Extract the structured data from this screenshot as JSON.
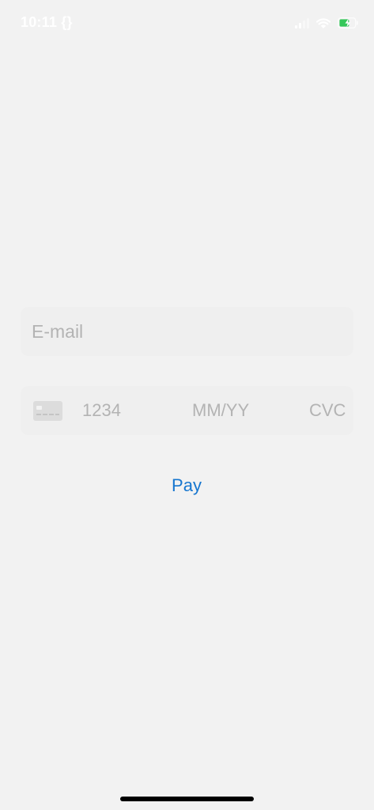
{
  "status_bar": {
    "time": "10:11 {}",
    "icons": [
      "cellular-signal-icon",
      "wifi-icon",
      "battery-charging-icon"
    ],
    "battery_color": "#34c759"
  },
  "form": {
    "email_placeholder": "E-mail",
    "card": {
      "icon": "credit-card-icon",
      "number_placeholder": "1234",
      "expiry_placeholder": "MM/YY",
      "cvc_placeholder": "CVC"
    },
    "pay_label": "Pay"
  },
  "colors": {
    "background": "#f2f2f2",
    "field_background": "#efefef",
    "placeholder": "#b3b3b3",
    "accent": "#1676cf"
  }
}
